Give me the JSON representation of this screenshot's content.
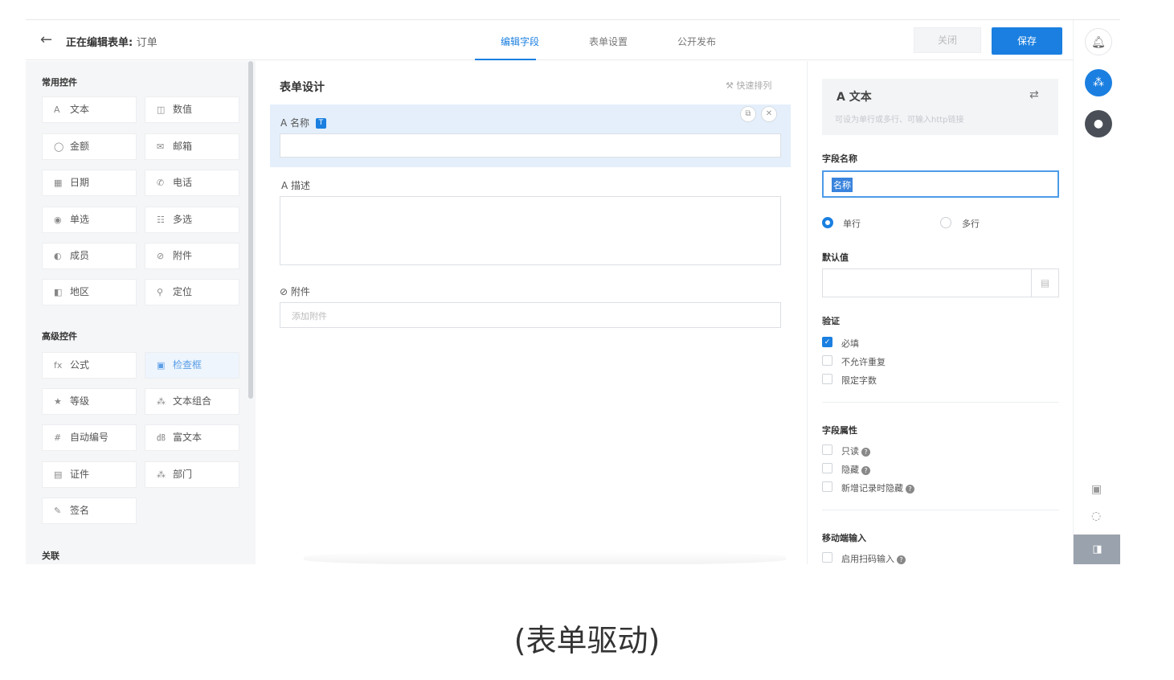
{
  "header": {
    "back_icon": "arrow-left-icon",
    "title_prefix": "正在编辑表单:",
    "title_name": "订单",
    "tabs": [
      "编辑字段",
      "表单设置",
      "公开发布"
    ],
    "active_tab": 0,
    "close_label": "关闭",
    "save_label": "保存",
    "accent_color": "#1a7fe0"
  },
  "left_panel": {
    "common_title": "常用控件",
    "common": [
      {
        "icon": "A",
        "label": "文本"
      },
      {
        "icon": "◫",
        "label": "数值"
      },
      {
        "icon": "◯",
        "label": "金额"
      },
      {
        "icon": "✉",
        "label": "邮箱"
      },
      {
        "icon": "▦",
        "label": "日期"
      },
      {
        "icon": "✆",
        "label": "电话"
      },
      {
        "icon": "◉",
        "label": "单选"
      },
      {
        "icon": "☷",
        "label": "多选"
      },
      {
        "icon": "◐",
        "label": "成员"
      },
      {
        "icon": "⊘",
        "label": "附件"
      },
      {
        "icon": "◧",
        "label": "地区"
      },
      {
        "icon": "⚲",
        "label": "定位"
      }
    ],
    "advanced_title": "高级控件",
    "advanced": [
      {
        "icon": "fx",
        "label": "公式"
      },
      {
        "icon": "▣",
        "label": "检查框"
      },
      {
        "icon": "★",
        "label": "等级"
      },
      {
        "icon": "⁂",
        "label": "文本组合"
      },
      {
        "icon": "#",
        "label": "自动编号"
      },
      {
        "icon": "㏈",
        "label": "富文本"
      },
      {
        "icon": "▤",
        "label": "证件"
      },
      {
        "icon": "⁂",
        "label": "部门"
      },
      {
        "icon": "✎",
        "label": "签名"
      }
    ],
    "related_title": "关联"
  },
  "center": {
    "title": "表单设计",
    "quick_arrange": "快速排列",
    "fields": [
      {
        "icon": "A",
        "label": "名称",
        "badge": "T"
      },
      {
        "icon": "A",
        "label": "描述"
      },
      {
        "icon": "⊘",
        "label": "附件",
        "placeholder": "添加附件"
      }
    ]
  },
  "props": {
    "type_title": "文本",
    "type_desc": "可设为单行或多行、可输入http链接",
    "field_name_label": "字段名称",
    "field_name_value": "名称",
    "single_line": "单行",
    "multi_line": "多行",
    "default_label": "默认值",
    "validation_label": "验证",
    "validation": [
      {
        "label": "必填",
        "checked": true
      },
      {
        "label": "不允许重复",
        "checked": false
      },
      {
        "label": "限定字数",
        "checked": false
      }
    ],
    "attributes_label": "字段属性",
    "attributes": [
      {
        "label": "只读",
        "checked": false
      },
      {
        "label": "隐藏",
        "checked": false
      },
      {
        "label": "新增记录时隐藏",
        "checked": false
      }
    ],
    "mobile_label": "移动端输入",
    "mobile": [
      {
        "label": "启用扫码输入",
        "checked": false
      }
    ]
  },
  "caption": "(表单驱动)"
}
